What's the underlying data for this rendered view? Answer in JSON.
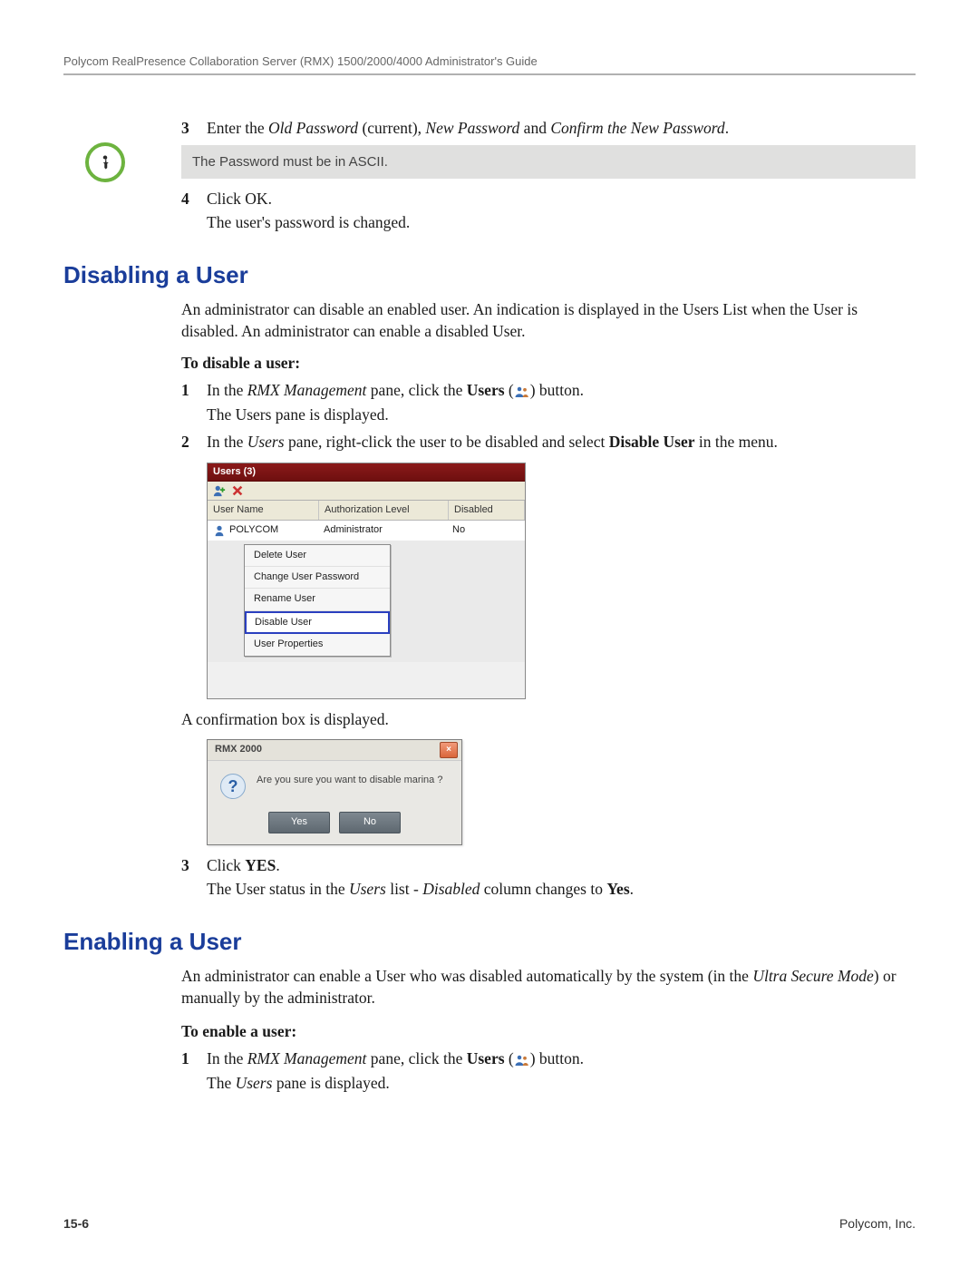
{
  "header": {
    "guide_title": "Polycom RealPresence Collaboration Server (RMX) 1500/2000/4000 Administrator's Guide"
  },
  "steps_top": {
    "s3_num": "3",
    "s3_a": "Enter the ",
    "s3_b": "Old Password",
    "s3_c": " (current), ",
    "s3_d": "New Password",
    "s3_e": " and ",
    "s3_f": "Confirm the New Password",
    "s3_g": "."
  },
  "note": {
    "text": "The Password must be in ASCII."
  },
  "steps_top2": {
    "s4_num": "4",
    "s4_a": "Click OK.",
    "s4_res": "The user's password is changed."
  },
  "disabling": {
    "heading": "Disabling a User",
    "intro": "An administrator can disable an enabled user. An indication is displayed in the Users List when the User is disabled. An administrator can enable a disabled User.",
    "proc_label": "To disable a user:",
    "s1_num": "1",
    "s1_a": "In the ",
    "s1_b": "RMX Management",
    "s1_c": " pane, click the ",
    "s1_d": "Users",
    "s1_e": " (",
    "s1_f": ") button.",
    "s1_res": "The Users pane is displayed.",
    "s2_num": "2",
    "s2_a": "In the ",
    "s2_b": "Users",
    "s2_c": " pane, right-click the user to be disabled and select ",
    "s2_d": "Disable User",
    "s2_e": " in the menu.",
    "confirm_text": "A confirmation box is displayed.",
    "s3_num": "3",
    "s3_a": "Click ",
    "s3_b": "YES",
    "s3_c": ".",
    "s3_res_a": "The User status in the ",
    "s3_res_b": "Users",
    "s3_res_c": " list - ",
    "s3_res_d": "Disabled",
    "s3_res_e": " column changes to ",
    "s3_res_f": "Yes",
    "s3_res_g": "."
  },
  "users_pane": {
    "title": "Users (3)",
    "col_user": "User Name",
    "col_auth": "Authorization Level",
    "col_dis": "Disabled",
    "row_user": "POLYCOM",
    "row_auth": "Administrator",
    "row_dis": "No",
    "menu": {
      "delete": "Delete User",
      "change": "Change User Password",
      "rename": "Rename User",
      "disable": "Disable User",
      "props": "User Properties"
    }
  },
  "dialog": {
    "title": "RMX 2000",
    "msg": "Are you sure you want to disable marina ?",
    "yes": "Yes",
    "no": "No"
  },
  "enabling": {
    "heading": "Enabling a User",
    "intro_a": "An administrator can enable a User who was disabled automatically by the system (in the ",
    "intro_b": "Ultra Secure Mode",
    "intro_c": ") or manually by the administrator.",
    "proc_label": "To enable a user:",
    "s1_num": "1",
    "s1_a": "In the ",
    "s1_b": "RMX Management",
    "s1_c": " pane, click the ",
    "s1_d": "Users",
    "s1_e": " (",
    "s1_f": ") button.",
    "s1_res_a": "The ",
    "s1_res_b": "Users",
    "s1_res_c": " pane is displayed."
  },
  "footer": {
    "page": "15-6",
    "brand": "Polycom, Inc."
  }
}
